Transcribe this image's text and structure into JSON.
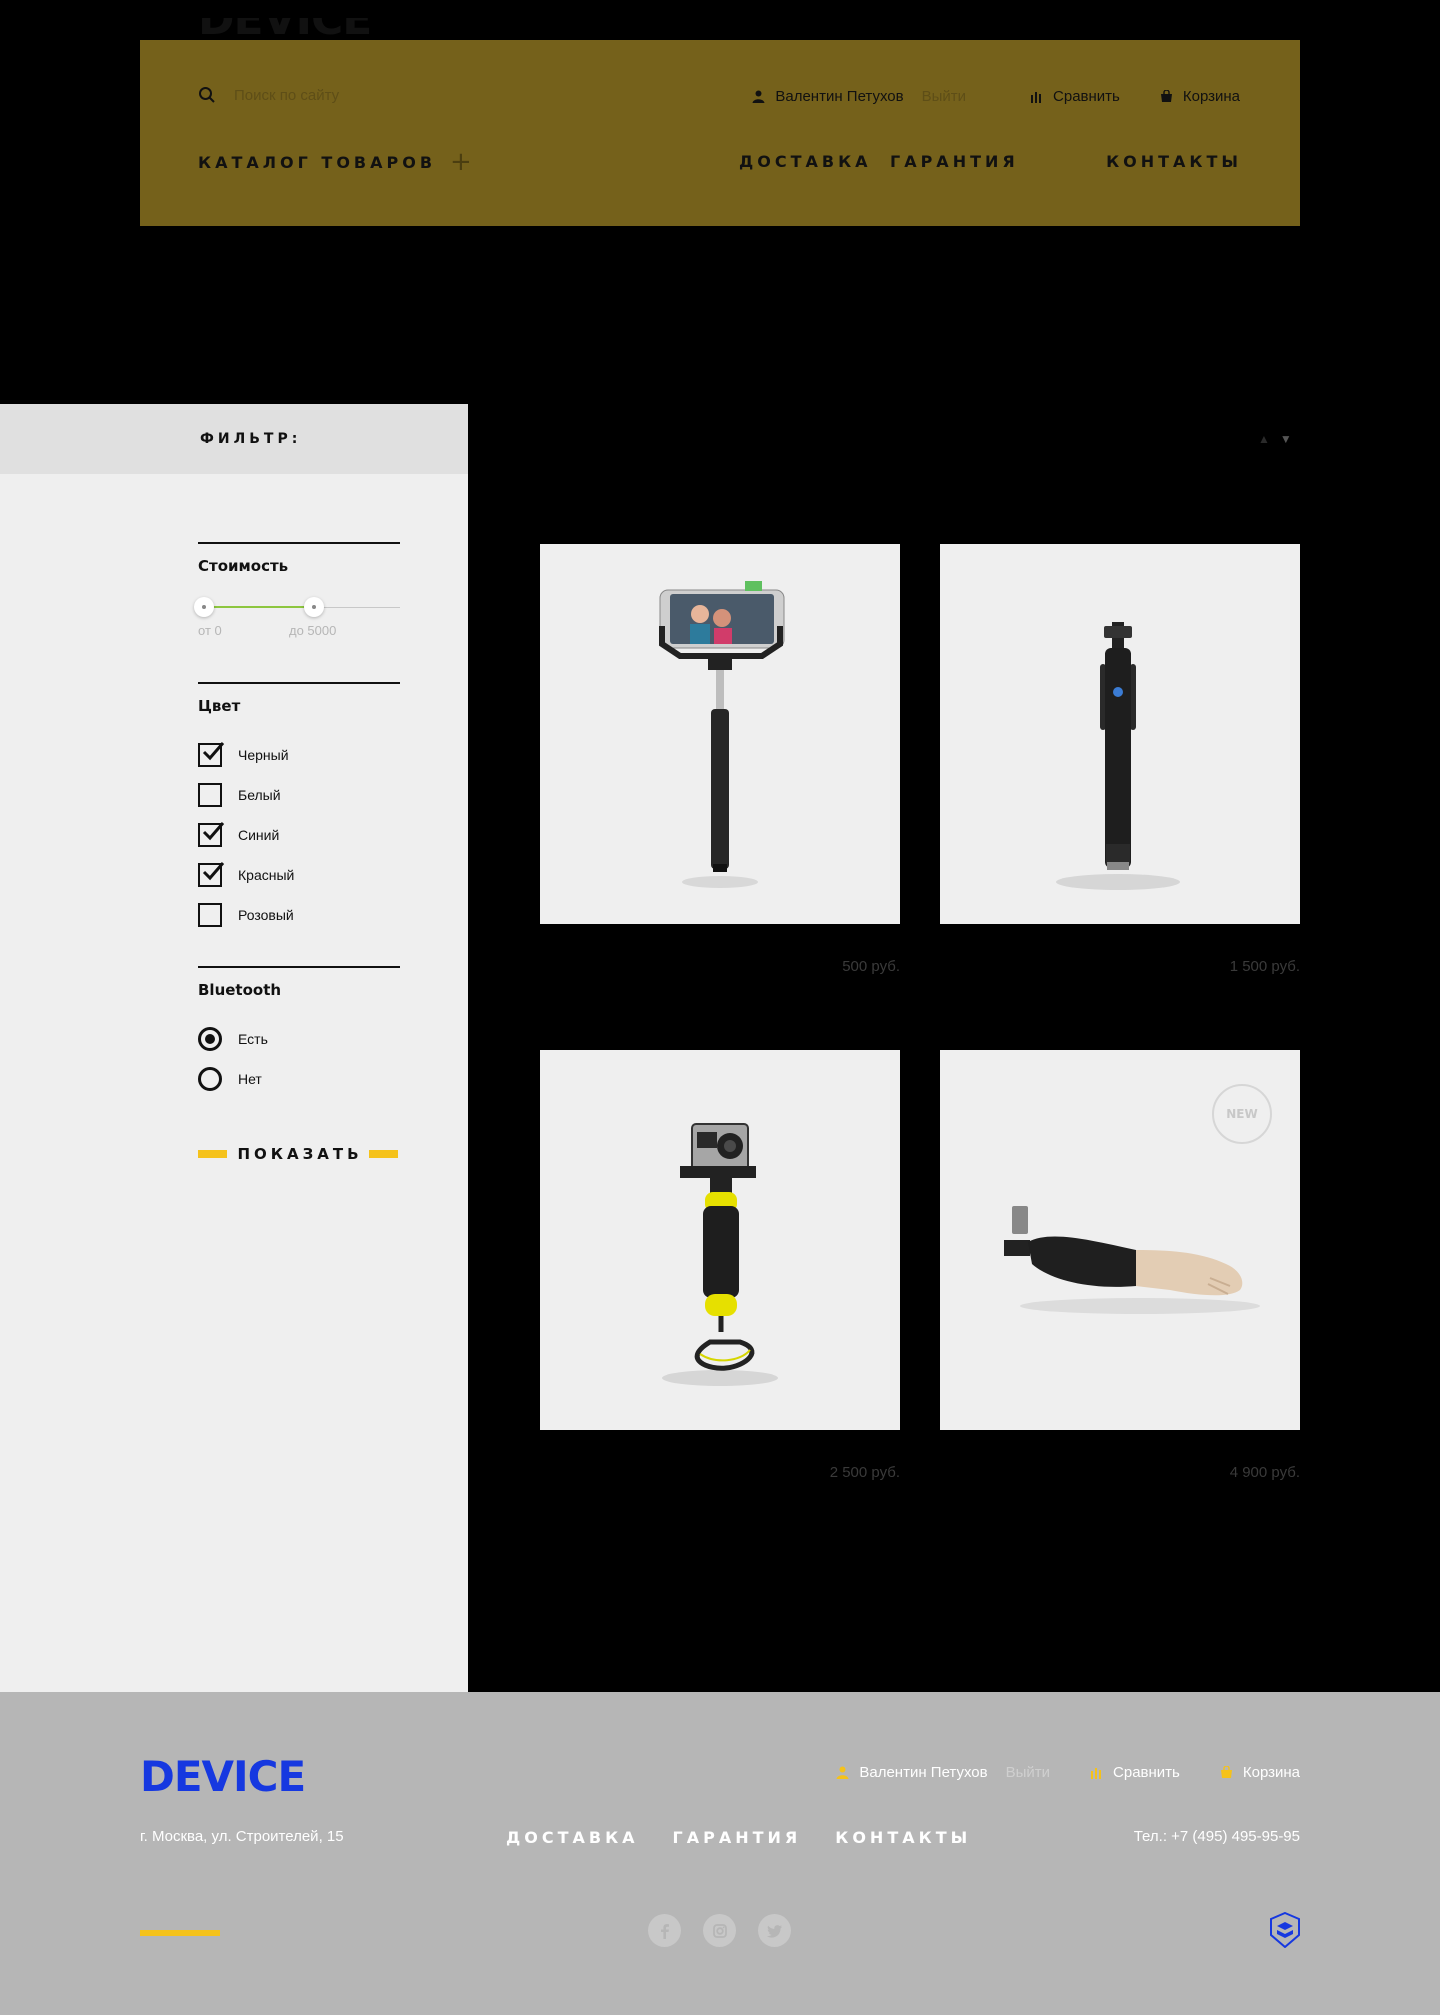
{
  "header": {
    "logo": "DEVICE",
    "search_placeholder": "Поиск по сайту",
    "user_name": "Валентин Петухов",
    "logout": "Выйти",
    "compare": "Сравнить",
    "cart": "Корзина",
    "catalog": "КАТАЛОГ ТОВАРОВ",
    "nav": [
      "ДОСТАВКА",
      "ГАРАНТИЯ",
      "КОНТАКТЫ"
    ]
  },
  "filter": {
    "title": "ФИЛЬТР:",
    "price": {
      "title": "Стоимость",
      "from_label": "от 0",
      "to_label": "до 5000",
      "min_value": 0,
      "max_value": 5000
    },
    "color": {
      "title": "Цвет",
      "options": [
        {
          "label": "Черный",
          "checked": true
        },
        {
          "label": "Белый",
          "checked": false
        },
        {
          "label": "Синий",
          "checked": true
        },
        {
          "label": "Красный",
          "checked": true
        },
        {
          "label": "Розовый",
          "checked": false
        }
      ]
    },
    "bluetooth": {
      "title": "Bluetooth",
      "options": [
        {
          "label": "Есть",
          "selected": true
        },
        {
          "label": "Нет",
          "selected": false
        }
      ]
    },
    "show_button": "ПОКАЗАТЬ"
  },
  "sort": {
    "up_icon": "▲",
    "down_icon": "▼"
  },
  "products": [
    {
      "price": "500 руб.",
      "image": "selfie-stick-with-phone"
    },
    {
      "price": "1 500 руб.",
      "image": "compact-selfie-stick"
    },
    {
      "price": "2 500 руб.",
      "image": "action-camera-float-grip"
    },
    {
      "price": "4 900 руб.",
      "image": "hand-selfie-stick",
      "badge": "NEW"
    }
  ],
  "footer": {
    "logo": "DEVICE",
    "address": "г. Москва, ул. Строителей, 15",
    "user_name": "Валентин Петухов",
    "logout": "Выйти",
    "compare": "Сравнить",
    "cart": "Корзина",
    "nav": [
      "ДОСТАВКА",
      "ГАРАНТИЯ",
      "КОНТАКТЫ"
    ],
    "phone": "Тел.: +7 (495) 495-95-95",
    "social": [
      "facebook-icon",
      "instagram-icon",
      "twitter-icon"
    ]
  },
  "colors": {
    "header_bg": "#75611b",
    "accent_yellow": "#f5c21b",
    "brand_blue": "#1638e0",
    "slider_green": "#8dc63f",
    "footer_bg": "#b6b6b6"
  }
}
